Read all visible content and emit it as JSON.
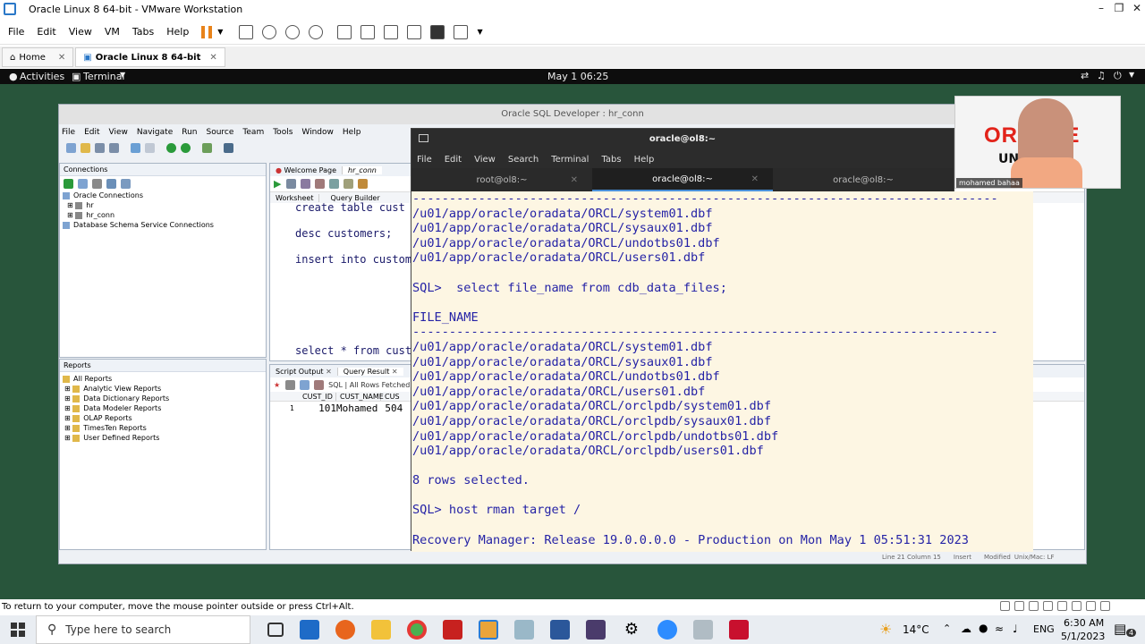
{
  "vmware": {
    "title": "Oracle Linux 8 64-bit - VMware Workstation",
    "menu": [
      "File",
      "Edit",
      "View",
      "VM",
      "Tabs",
      "Help"
    ],
    "tabs": [
      {
        "label": "Home"
      },
      {
        "label": "Oracle Linux 8 64-bit"
      }
    ],
    "status_text": "To return to your computer, move the mouse pointer outside or press Ctrl+Alt."
  },
  "gnome": {
    "activities": "Activities",
    "app_menu": "Terminal",
    "clock": "May 1  06:25"
  },
  "sqldev": {
    "title": "Oracle SQL Developer : hr_conn",
    "menu": [
      "File",
      "Edit",
      "View",
      "Navigate",
      "Run",
      "Source",
      "Team",
      "Tools",
      "Window",
      "Help"
    ],
    "connections_label": "Connections",
    "connections_tree": [
      "Oracle Connections",
      "hr",
      "hr_conn",
      "Database Schema Service Connections"
    ],
    "reports_label": "Reports",
    "reports_tree": [
      "All Reports",
      "Analytic View Reports",
      "Data Dictionary Reports",
      "Data Modeler Reports",
      "OLAP Reports",
      "TimesTen Reports",
      "User Defined Reports"
    ],
    "editor_tabs": [
      "Welcome Page",
      "hr_conn"
    ],
    "worksheet_tabs": [
      "Worksheet",
      "Query Builder"
    ],
    "code_lines": [
      "create table cust",
      "desc customers;",
      "insert into custom",
      "select * from cust"
    ],
    "result_tabs": [
      "Script Output",
      "Query Result"
    ],
    "result_toolbar": "SQL  |  All Rows Fetched:",
    "result_columns": [
      "CUST_ID",
      "CUST_NAME",
      "CUS"
    ],
    "result_row": {
      "num": "1",
      "id": "101",
      "name": "Mohamed",
      "extra": "504"
    },
    "status_right": [
      "Line 21 Column 15",
      "Insert",
      "Modified",
      "Unix/Mac: LF"
    ]
  },
  "terminal": {
    "title": "oracle@ol8:~",
    "menu": [
      "File",
      "Edit",
      "View",
      "Search",
      "Terminal",
      "Tabs",
      "Help"
    ],
    "tabs": [
      {
        "label": "root@ol8:~"
      },
      {
        "label": "oracle@ol8:~"
      },
      {
        "label": "oracle@ol8:~"
      }
    ],
    "lines": [
      "--------------------------------------------------------------------------------",
      "/u01/app/oracle/oradata/ORCL/system01.dbf",
      "/u01/app/oracle/oradata/ORCL/sysaux01.dbf",
      "/u01/app/oracle/oradata/ORCL/undotbs01.dbf",
      "/u01/app/oracle/oradata/ORCL/users01.dbf",
      "",
      "SQL>  select file_name from cdb_data_files;",
      "",
      "FILE_NAME",
      "--------------------------------------------------------------------------------",
      "/u01/app/oracle/oradata/ORCL/system01.dbf",
      "/u01/app/oracle/oradata/ORCL/sysaux01.dbf",
      "/u01/app/oracle/oradata/ORCL/undotbs01.dbf",
      "/u01/app/oracle/oradata/ORCL/users01.dbf",
      "/u01/app/oracle/oradata/ORCL/orclpdb/system01.dbf",
      "/u01/app/oracle/oradata/ORCL/orclpdb/sysaux01.dbf",
      "/u01/app/oracle/oradata/ORCL/orclpdb/undotbs01.dbf",
      "/u01/app/oracle/oradata/ORCL/orclpdb/users01.dbf",
      "",
      "8 rows selected.",
      "",
      "SQL> host rman target /",
      "",
      "Recovery Manager: Release 19.0.0.0.0 - Production on Mon May 1 05:51:31 2023"
    ]
  },
  "webcam": {
    "brand": "ORACLE",
    "brand_sub": "UNIV",
    "name": "mohamed bahaa"
  },
  "taskbar": {
    "search_placeholder": "Type here to search",
    "weather": "14°C",
    "language": "ENG",
    "time": "6:30 AM",
    "date": "5/1/2023",
    "notification_count": "4"
  },
  "colors": {
    "desktop": "#28553b",
    "terminal_text": "#2523a6",
    "terminal_bg": "#fdf6e3",
    "oracle_red": "#e2231a"
  }
}
